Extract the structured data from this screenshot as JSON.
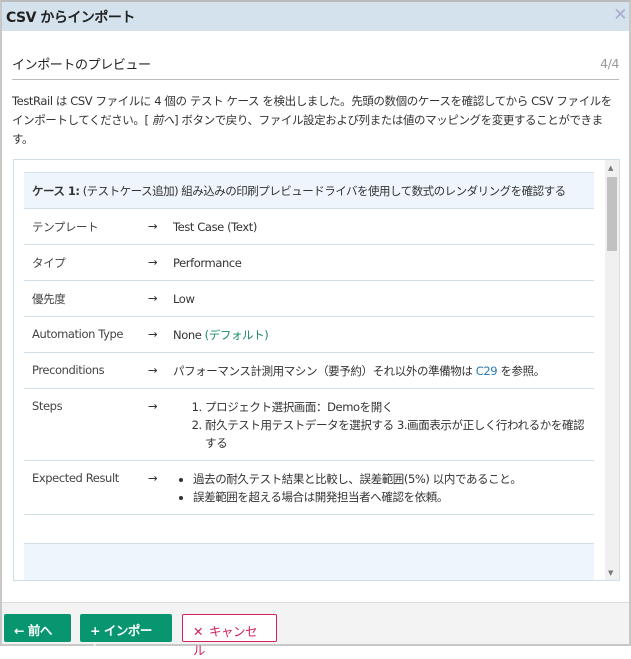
{
  "dialog": {
    "title": "CSV からインポート",
    "close_icon": "close-icon"
  },
  "section": {
    "title": "インポートのプレビュー",
    "step": "4/4"
  },
  "intro": {
    "part1": "TestRail は CSV ファイルに 4 個の テスト ケース を検出しました。先頭の数個のケースを確認してから CSV ファイルをインポートしてください。[ ",
    "prev_italic": "前へ",
    "part2": "] ボタンで戻り、ファイル設定および列または値のマッピングを変更することができます。"
  },
  "case": {
    "prefix": "ケース 1:",
    "title": "(テストケース追加) 組み込みの印刷プレビュードライバを使用して数式のレンダリングを確認する",
    "arrow": "→",
    "fields": [
      {
        "label": "テンプレート",
        "value": "Test Case (Text)"
      },
      {
        "label": "タイプ",
        "value": "Performance"
      },
      {
        "label": "優先度",
        "value": "Low"
      },
      {
        "label": "Automation Type",
        "value": "None",
        "note": "(デフォルト)"
      },
      {
        "label": "Preconditions",
        "value": "パフォーマンス計測用マシン（要予約）それ以外の準備物は ",
        "link": "C29",
        "value_after": " を参照。"
      },
      {
        "label": "Steps",
        "items": [
          "プロジェクト選択画面：Demoを開く",
          "耐久テスト用テストデータを選択する 3.画面表示が正しく行われるかを確認する"
        ]
      },
      {
        "label": "Expected Result",
        "items": [
          "過去の耐久テスト結果と比較し、誤差範囲(5%) 以内であること。",
          "誤差範囲を超える場合は開発担当者へ確認を依頼。"
        ]
      }
    ]
  },
  "colors": {
    "accent": "#079670",
    "cancel": "#d0215b",
    "titlebar": "#d3e2ec",
    "link": "#2a7ab0"
  },
  "footer": {
    "prev_label": "前へ",
    "import_label": "インポート",
    "cancel_label": "キャンセル"
  }
}
